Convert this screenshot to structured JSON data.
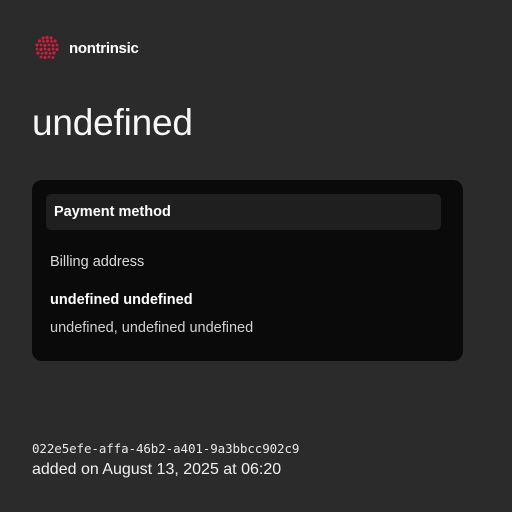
{
  "brand": {
    "name": "nontrinsic",
    "logo_icon": "brain-logo-icon",
    "logo_color": "#c2223f"
  },
  "page": {
    "title": "undefined"
  },
  "card": {
    "header": "Payment method",
    "billing_label": "Billing address",
    "billing_name": "undefined undefined",
    "billing_line": "undefined, undefined undefined"
  },
  "footer": {
    "id": "022e5efe-affa-46b2-a401-9a3bbcc902c9",
    "added_on": "added on August 13, 2025 at 06:20"
  }
}
